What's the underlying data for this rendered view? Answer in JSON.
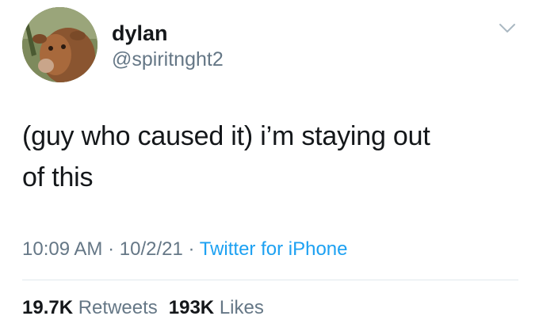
{
  "user": {
    "display_name": "dylan",
    "handle": "@spiritnght2"
  },
  "tweet": {
    "text_line1": "(guy who caused it) i’m staying out",
    "text_line2": "of this",
    "time": "10:09 AM",
    "date": "10/2/21",
    "separator": "·",
    "source": "Twitter for iPhone"
  },
  "stats": {
    "retweets_count": "19.7K",
    "retweets_label": "Retweets",
    "likes_count": "193K",
    "likes_label": "Likes"
  },
  "icons": {
    "more": "chevron-down-icon",
    "avatar": "cow-avatar"
  },
  "colors": {
    "text": "#14171a",
    "secondary": "#657786",
    "link": "#1da1f2",
    "divider": "#e1e8ed"
  }
}
